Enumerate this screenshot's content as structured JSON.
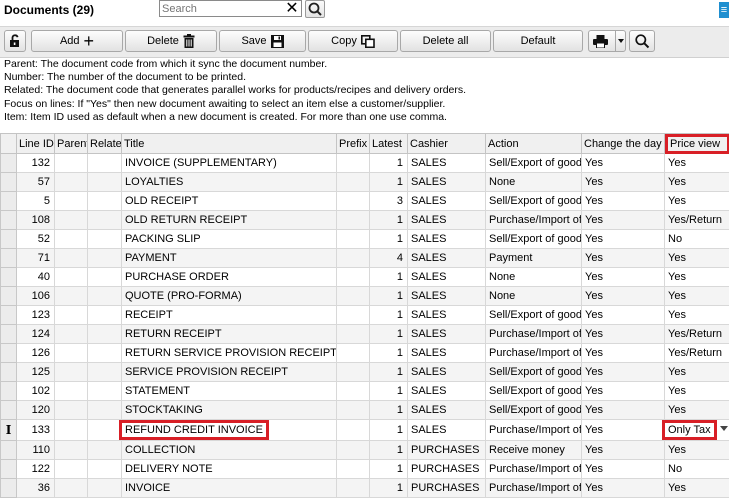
{
  "header": {
    "title": "Documents (29)",
    "search_placeholder": "Search",
    "search_value": ""
  },
  "toolbar": {
    "add_label": "Add",
    "delete_label": "Delete",
    "save_label": "Save",
    "copy_label": "Copy",
    "delete_all_label": "Delete all",
    "default_label": "Default"
  },
  "info_lines": [
    "Parent: The document code from which it sync the document number.",
    "Number: The number of the document to be printed.",
    "Related: The document code that generates parallel works for products/recipes and delivery orders.",
    "Focus on lines: If \"Yes\" then new document awaiting to select an item else a customer/supplier.",
    "Item: Item ID used as default when a new document is created. For more than one use comma."
  ],
  "table": {
    "columns": [
      "Line ID",
      "Parent",
      "Relate",
      "Title",
      "Prefix",
      "Latest",
      "Cashier",
      "Action",
      "Change the day",
      "Price view"
    ],
    "rows": [
      {
        "id": "132",
        "title": "INVOICE (SUPPLEMENTARY)",
        "latest": "1",
        "cashier": "SALES",
        "action": "Sell/Export of good",
        "change": "Yes",
        "price": "Yes"
      },
      {
        "id": "57",
        "title": "LOYALTIES",
        "latest": "1",
        "cashier": "SALES",
        "action": "None",
        "change": "Yes",
        "price": "Yes"
      },
      {
        "id": "5",
        "title": "OLD RECEIPT",
        "latest": "3",
        "cashier": "SALES",
        "action": "Sell/Export of good",
        "change": "Yes",
        "price": "Yes"
      },
      {
        "id": "108",
        "title": "OLD RETURN RECEIPT",
        "latest": "1",
        "cashier": "SALES",
        "action": "Purchase/Import of",
        "change": "Yes",
        "price": "Yes/Return"
      },
      {
        "id": "52",
        "title": "PACKING SLIP",
        "latest": "1",
        "cashier": "SALES",
        "action": "Sell/Export of good",
        "change": "Yes",
        "price": "No"
      },
      {
        "id": "71",
        "title": "PAYMENT",
        "latest": "4",
        "cashier": "SALES",
        "action": "Payment",
        "change": "Yes",
        "price": "Yes"
      },
      {
        "id": "40",
        "title": "PURCHASE ORDER",
        "latest": "1",
        "cashier": "SALES",
        "action": "None",
        "change": "Yes",
        "price": "Yes"
      },
      {
        "id": "106",
        "title": "QUOTE (PRO-FORMA)",
        "latest": "1",
        "cashier": "SALES",
        "action": "None",
        "change": "Yes",
        "price": "Yes"
      },
      {
        "id": "123",
        "title": "RECEIPT",
        "latest": "1",
        "cashier": "SALES",
        "action": "Sell/Export of good",
        "change": "Yes",
        "price": "Yes"
      },
      {
        "id": "124",
        "title": "RETURN RECEIPT",
        "latest": "1",
        "cashier": "SALES",
        "action": "Purchase/Import of",
        "change": "Yes",
        "price": "Yes/Return"
      },
      {
        "id": "126",
        "title": "RETURN SERVICE PROVISION RECEIPT",
        "latest": "1",
        "cashier": "SALES",
        "action": "Purchase/Import of",
        "change": "Yes",
        "price": "Yes/Return"
      },
      {
        "id": "125",
        "title": "SERVICE PROVISION RECEIPT",
        "latest": "1",
        "cashier": "SALES",
        "action": "Sell/Export of good",
        "change": "Yes",
        "price": "Yes"
      },
      {
        "id": "102",
        "title": "STATEMENT",
        "latest": "1",
        "cashier": "SALES",
        "action": "Sell/Export of good",
        "change": "Yes",
        "price": "Yes"
      },
      {
        "id": "120",
        "title": "STOCKTAKING",
        "latest": "1",
        "cashier": "SALES",
        "action": "Sell/Export of good",
        "change": "Yes",
        "price": "Yes"
      },
      {
        "id": "133",
        "title": "REFUND CREDIT INVOICE",
        "latest": "1",
        "cashier": "SALES",
        "action": "Purchase/Import of",
        "change": "Yes",
        "price": "Only Tax"
      },
      {
        "id": "110",
        "title": "COLLECTION",
        "latest": "1",
        "cashier": "PURCHASES",
        "action": "Receive money",
        "change": "Yes",
        "price": "Yes"
      },
      {
        "id": "122",
        "title": "DELIVERY NOTE",
        "latest": "1",
        "cashier": "PURCHASES",
        "action": "Purchase/Import of",
        "change": "Yes",
        "price": "No"
      },
      {
        "id": "36",
        "title": "INVOICE",
        "latest": "1",
        "cashier": "PURCHASES",
        "action": "Purchase/Import of",
        "change": "Yes",
        "price": "Yes"
      }
    ]
  },
  "colors": {
    "highlight": "#d81f26",
    "accent": "#1f8fd0"
  }
}
